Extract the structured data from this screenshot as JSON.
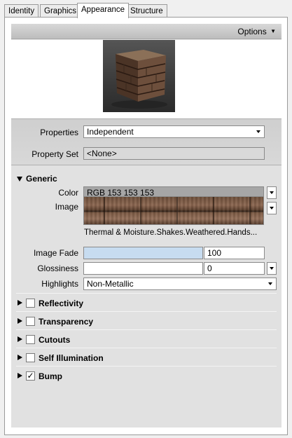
{
  "tabs": [
    {
      "label": "Identity"
    },
    {
      "label": "Graphics"
    },
    {
      "label": "Appearance"
    },
    {
      "label": "Structure"
    }
  ],
  "options_label": "Options",
  "properties": {
    "label": "Properties",
    "value": "Independent",
    "property_set_label": "Property Set",
    "property_set_value": "<None>"
  },
  "generic": {
    "title": "Generic",
    "color_label": "Color",
    "color_value": "RGB 153 153 153",
    "image_label": "Image",
    "image_name": "Thermal & Moisture.Shakes.Weathered.Hands...",
    "image_fade_label": "Image Fade",
    "image_fade_value": "100",
    "glossiness_label": "Glossiness",
    "glossiness_value": "0",
    "highlights_label": "Highlights",
    "highlights_value": "Non-Metallic"
  },
  "sections": [
    {
      "label": "Reflectivity",
      "checked": false
    },
    {
      "label": "Transparency",
      "checked": false
    },
    {
      "label": "Cutouts",
      "checked": false
    },
    {
      "label": "Self Illumination",
      "checked": false
    },
    {
      "label": "Bump",
      "checked": true
    }
  ],
  "colors": {
    "panel_bg": "#e1e1e1",
    "color_swatch": "#999999",
    "image_fade_bar": "#c7dcf0"
  }
}
